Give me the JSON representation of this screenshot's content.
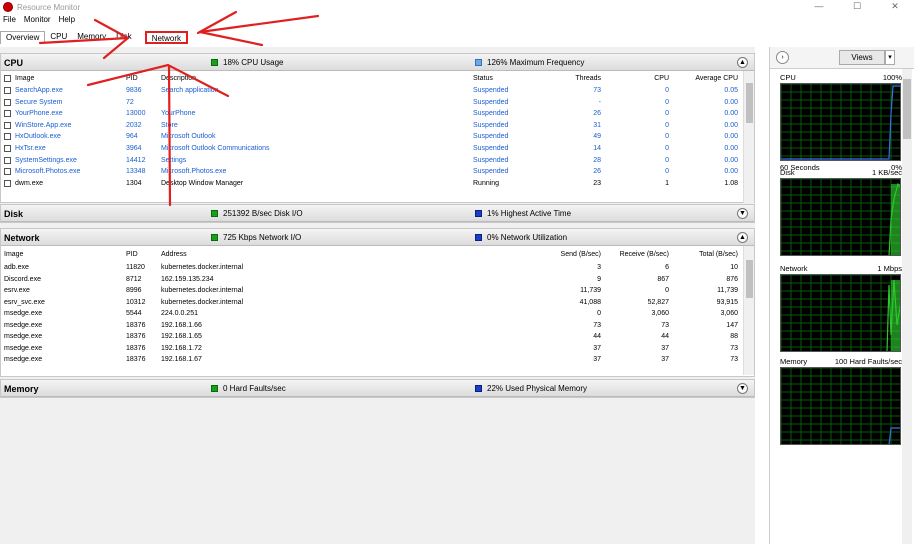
{
  "window": {
    "title": "Resource Monitor",
    "controls": [
      "—",
      "☐",
      "✕"
    ]
  },
  "menu": [
    "File",
    "Monitor",
    "Help"
  ],
  "tabs": [
    "Overview",
    "CPU",
    "Memory",
    "Disk",
    "Network"
  ],
  "cpu": {
    "title": "CPU",
    "stat1": "18% CPU Usage",
    "stat2": "126% Maximum Frequency",
    "headers": [
      "Image",
      "PID",
      "Description",
      "Status",
      "Threads",
      "CPU",
      "Average CPU"
    ],
    "rows": [
      [
        "SearchApp.exe",
        "9836",
        "Search application",
        "Suspended",
        "73",
        "0",
        "0.05"
      ],
      [
        "Secure System",
        "72",
        "",
        "Suspended",
        "-",
        "0",
        "0.00"
      ],
      [
        "YourPhone.exe",
        "13000",
        "YourPhone",
        "Suspended",
        "26",
        "0",
        "0.00"
      ],
      [
        "WinStore.App.exe",
        "2032",
        "Store",
        "Suspended",
        "31",
        "0",
        "0.00"
      ],
      [
        "HxOutlook.exe",
        "964",
        "Microsoft Outlook",
        "Suspended",
        "49",
        "0",
        "0.00"
      ],
      [
        "HxTsr.exe",
        "3964",
        "Microsoft Outlook Communications",
        "Suspended",
        "14",
        "0",
        "0.00"
      ],
      [
        "SystemSettings.exe",
        "14412",
        "Settings",
        "Suspended",
        "28",
        "0",
        "0.00"
      ],
      [
        "Microsoft.Photos.exe",
        "13348",
        "Microsoft.Photos.exe",
        "Suspended",
        "26",
        "0",
        "0.00"
      ],
      [
        "dwm.exe",
        "1304",
        "Desktop Window Manager",
        "Running",
        "23",
        "1",
        "1.08"
      ]
    ]
  },
  "disk": {
    "title": "Disk",
    "stat1": "251392 B/sec Disk I/O",
    "stat2": "1% Highest Active Time"
  },
  "network": {
    "title": "Network",
    "stat1": "725 Kbps Network I/O",
    "stat2": "0% Network Utilization",
    "headers": [
      "Image",
      "PID",
      "Address",
      "Send (B/sec)",
      "Receive (B/sec)",
      "Total (B/sec)"
    ],
    "rows": [
      [
        "adb.exe",
        "11820",
        "kubernetes.docker.internal",
        "3",
        "6",
        "10"
      ],
      [
        "Discord.exe",
        "8712",
        "162.159.135.234",
        "9",
        "867",
        "876"
      ],
      [
        "esrv.exe",
        "8996",
        "kubernetes.docker.internal",
        "11,739",
        "0",
        "11,739"
      ],
      [
        "esrv_svc.exe",
        "10312",
        "kubernetes.docker.internal",
        "41,088",
        "52,827",
        "93,915"
      ],
      [
        "msedge.exe",
        "5544",
        "224.0.0.251",
        "0",
        "3,060",
        "3,060"
      ],
      [
        "msedge.exe",
        "18376",
        "192.168.1.66",
        "73",
        "73",
        "147"
      ],
      [
        "msedge.exe",
        "18376",
        "192.168.1.65",
        "44",
        "44",
        "88"
      ],
      [
        "msedge.exe",
        "18376",
        "192.168.1.72",
        "37",
        "37",
        "73"
      ],
      [
        "msedge.exe",
        "18376",
        "192.168.1.67",
        "37",
        "37",
        "73"
      ]
    ]
  },
  "memory": {
    "title": "Memory",
    "stat1": "0 Hard Faults/sec",
    "stat2": "22% Used Physical Memory"
  },
  "side": {
    "views_label": "Views",
    "graphs": [
      {
        "name": "CPU",
        "max": "100%",
        "foot_left": "60 Seconds",
        "foot_right": "0%"
      },
      {
        "name": "Disk",
        "max": "1 KB/sec",
        "foot_left": "",
        "foot_right": "0"
      },
      {
        "name": "Network",
        "max": "1 Mbps",
        "foot_left": "",
        "foot_right": "0"
      },
      {
        "name": "Memory",
        "max": "100 Hard Faults/sec",
        "foot_left": "",
        "foot_right": "0%"
      }
    ]
  },
  "colors": {
    "green": "#1aa01a",
    "blue": "#1a3ec8",
    "link": "#1a5fd0",
    "annotation": "#e02020"
  }
}
